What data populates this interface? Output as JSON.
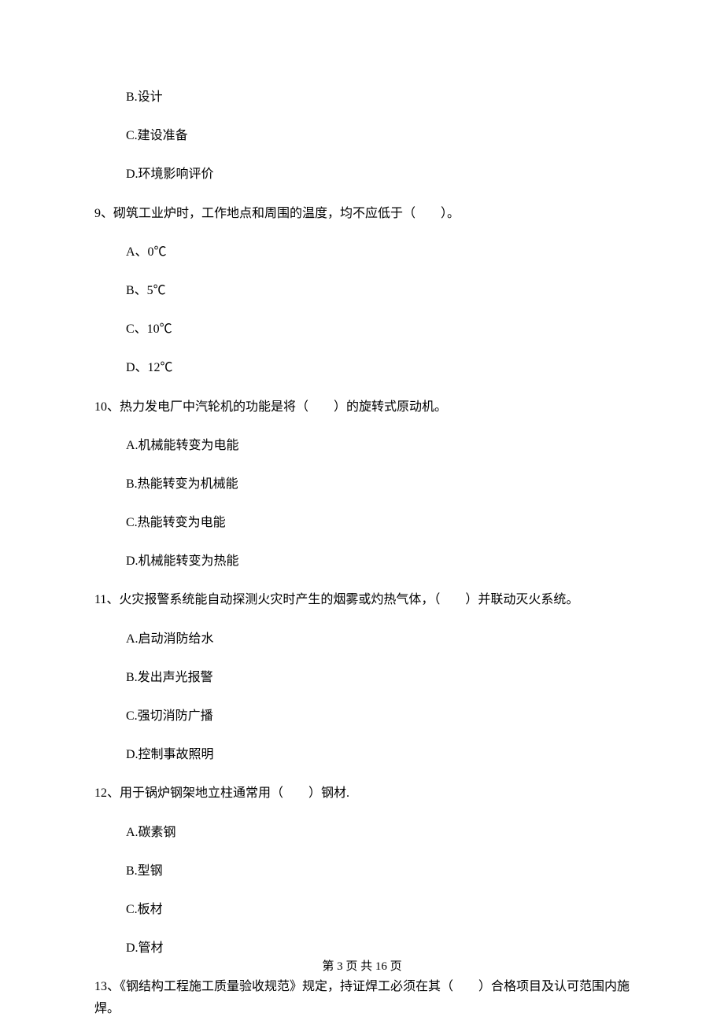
{
  "q8_options": {
    "b": "B.设计",
    "c": "C.建设准备",
    "d": "D.环境影响评价"
  },
  "q9": {
    "stem": "9、砌筑工业炉时，工作地点和周围的温度，均不应低于（　　）。",
    "a": "A、0℃",
    "b": "B、5℃",
    "c": "C、10℃",
    "d": "D、12℃"
  },
  "q10": {
    "stem": "10、热力发电厂中汽轮机的功能是将（　　）的旋转式原动机。",
    "a": "A.机械能转变为电能",
    "b": "B.热能转变为机械能",
    "c": "C.热能转变为电能",
    "d": "D.机械能转变为热能"
  },
  "q11": {
    "stem": "11、火灾报警系统能自动探测火灾时产生的烟雾或灼热气体，（　　）并联动灭火系统。",
    "a": "A.启动消防给水",
    "b": "B.发出声光报警",
    "c": "C.强切消防广播",
    "d": "D.控制事故照明"
  },
  "q12": {
    "stem": "12、用于锅炉钢架地立柱通常用（　　）钢材.",
    "a": "A.碳素钢",
    "b": "B.型钢",
    "c": "C.板材",
    "d": "D.管材"
  },
  "q13": {
    "stem": "13、《钢结构工程施工质量验收规范》规定，持证焊工必须在其（　　）合格项目及认可范围内施焊。"
  },
  "footer": "第 3 页 共 16 页"
}
